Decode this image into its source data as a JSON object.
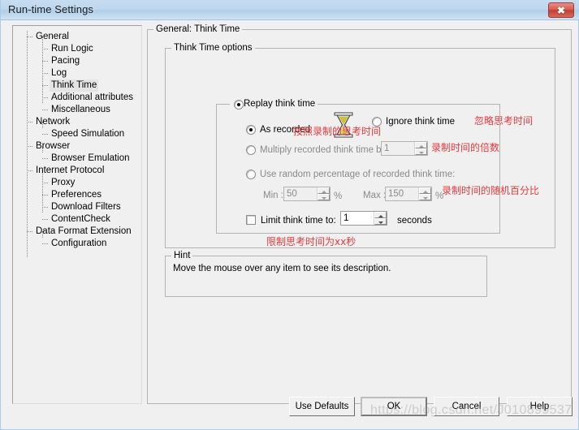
{
  "window": {
    "title": "Run-time Settings",
    "close_icon": "close-icon",
    "close_label": "✖"
  },
  "sidebar": {
    "items": [
      {
        "label": "General",
        "level": 0,
        "selected": false
      },
      {
        "label": "Run Logic",
        "level": 1,
        "selected": false
      },
      {
        "label": "Pacing",
        "level": 1,
        "selected": false
      },
      {
        "label": "Log",
        "level": 1,
        "selected": false
      },
      {
        "label": "Think Time",
        "level": 1,
        "selected": true
      },
      {
        "label": "Additional attributes",
        "level": 1,
        "selected": false
      },
      {
        "label": "Miscellaneous",
        "level": 1,
        "selected": false
      },
      {
        "label": "Network",
        "level": 0,
        "selected": false
      },
      {
        "label": "Speed Simulation",
        "level": 1,
        "selected": false
      },
      {
        "label": "Browser",
        "level": 0,
        "selected": false
      },
      {
        "label": "Browser Emulation",
        "level": 1,
        "selected": false
      },
      {
        "label": "Internet Protocol",
        "level": 0,
        "selected": false
      },
      {
        "label": "Proxy",
        "level": 1,
        "selected": false
      },
      {
        "label": "Preferences",
        "level": 1,
        "selected": false
      },
      {
        "label": "Download Filters",
        "level": 1,
        "selected": false
      },
      {
        "label": "ContentCheck",
        "level": 1,
        "selected": false
      },
      {
        "label": "Data Format Extension",
        "level": 0,
        "selected": false
      },
      {
        "label": "Configuration",
        "level": 1,
        "selected": false
      }
    ]
  },
  "main": {
    "group_title": "General: Think Time",
    "options_group_title": "Think Time options",
    "hourglass_icon": "hourglass-icon",
    "ignore_think_time": {
      "label": "Ignore think time",
      "checked": false,
      "annotation": "忽略思考时间"
    },
    "replay_think_time": {
      "label": "Replay think time",
      "checked": true
    },
    "as_recorded": {
      "label": "As recorded",
      "checked": true,
      "annotation": "按照录制的思考时间"
    },
    "multiply": {
      "label": "Multiply recorded think time by:",
      "checked": false,
      "value": "1",
      "disabled": true,
      "annotation": "录制时间的倍数"
    },
    "random_percentage": {
      "label": "Use random percentage of recorded think time:",
      "checked": false,
      "min_label": "Min :",
      "min_value": "50",
      "max_label": "Max :",
      "max_value": "150",
      "percent_sign": "%",
      "disabled": true,
      "annotation": "录制时间的随机百分比"
    },
    "limit": {
      "label": "Limit think time to:",
      "checked": false,
      "value": "1",
      "units": "seconds",
      "annotation": "限制思考时间为xx秒"
    },
    "hint": {
      "group_title": "Hint",
      "text": "Move the mouse over any item to see its description."
    }
  },
  "footer": {
    "buttons": [
      {
        "label": "Use Defaults",
        "default": false
      },
      {
        "label": "OK",
        "default": true
      },
      {
        "label": "Cancel",
        "default": false
      },
      {
        "label": "Help",
        "default": false
      }
    ],
    "watermark": "https://blog.csdn.net/J010899537"
  },
  "colors": {
    "accent": "#b2cee9",
    "annotation": "#e8393c",
    "close_button": "#c33f31",
    "window_bg": "#f0f0f0"
  }
}
